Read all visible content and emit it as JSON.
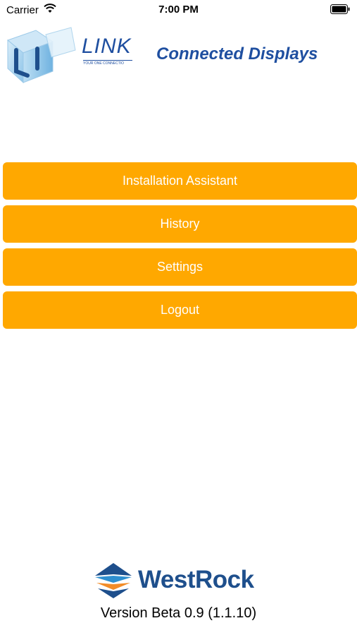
{
  "status_bar": {
    "carrier": "Carrier",
    "time": "7:00 PM",
    "wifi_icon": "wifi-icon",
    "battery_icon": "battery-icon"
  },
  "header": {
    "logo_word": "LINK",
    "logo_tagline": "YOUR ONE CONNECTIO",
    "title": "Connected Displays",
    "brand_color": "#1f4fa0"
  },
  "menu": {
    "button_color": "#ffa800",
    "items": [
      {
        "label": "Installation Assistant"
      },
      {
        "label": "History"
      },
      {
        "label": "Settings"
      },
      {
        "label": "Logout"
      }
    ]
  },
  "footer": {
    "brand": "WestRock",
    "version": "Version Beta 0.9 (1.1.10)",
    "brand_color": "#1e4f8c",
    "accent_color": "#f28c28"
  }
}
